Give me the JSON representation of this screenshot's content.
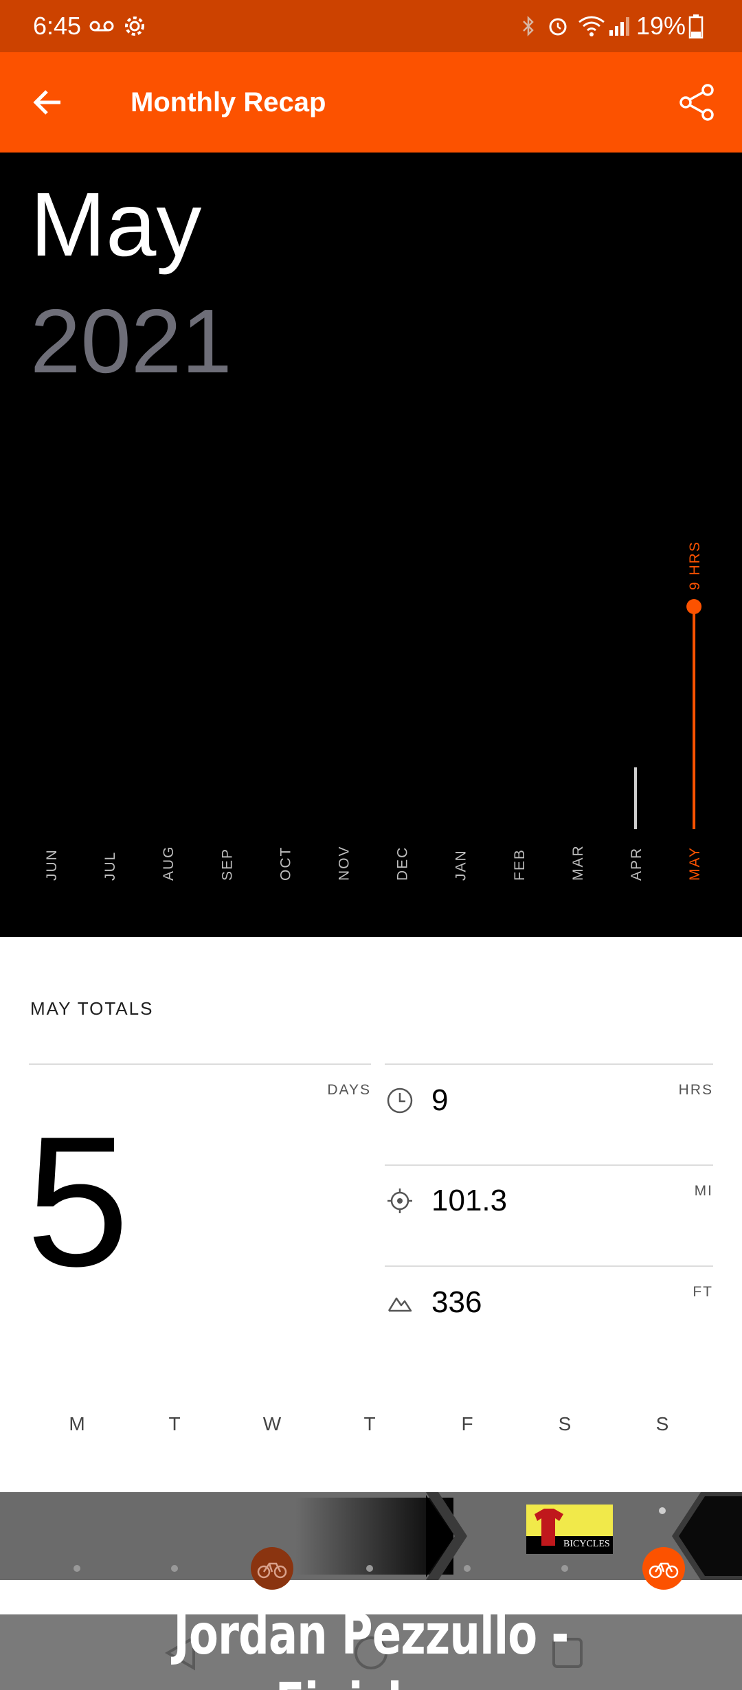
{
  "status_bar": {
    "time": "6:45",
    "battery": "19%",
    "icons": [
      "voicemail-icon",
      "settings-icon",
      "bluetooth-icon",
      "alarm-icon",
      "wifi-icon",
      "signal-icon",
      "battery-icon"
    ]
  },
  "app_bar": {
    "title": "Monthly Recap",
    "back_icon": "arrow-left-icon",
    "share_icon": "share-icon"
  },
  "hero": {
    "month": "May",
    "year": "2021"
  },
  "chart_data": {
    "type": "bar",
    "categories": [
      "JUN",
      "JUL",
      "AUG",
      "SEP",
      "OCT",
      "NOV",
      "DEC",
      "JAN",
      "FEB",
      "MAR",
      "APR",
      "MAY"
    ],
    "values": [
      0,
      0,
      0,
      0,
      0,
      0,
      0,
      0,
      0,
      0,
      2.5,
      9
    ],
    "highlight": "MAY",
    "highlight_label": "9 HRS",
    "ylim": [
      0,
      10
    ],
    "unit": "HRS",
    "colors": {
      "bar": "#cfcfcf",
      "highlight": "#fc5200",
      "axis_label": "#bdbdbd"
    }
  },
  "totals": {
    "heading": "MAY TOTALS",
    "days": {
      "value": "5",
      "unit": "DAYS"
    },
    "time": {
      "value": "9",
      "unit": "HRS",
      "icon": "clock-icon"
    },
    "distance": {
      "value": "101.3",
      "unit": "MI",
      "icon": "target-icon"
    },
    "elevation": {
      "value": "336",
      "unit": "FT",
      "icon": "mountain-icon"
    }
  },
  "week": {
    "days": [
      "M",
      "T",
      "W",
      "T",
      "F",
      "S",
      "S"
    ],
    "activity_days": [
      "W",
      "S"
    ]
  },
  "ad": {
    "thumb_text": "BICYCLES"
  },
  "overlay": {
    "caption": "Jordan Pezzullo - Finisher"
  },
  "colors": {
    "accent": "#fc5200",
    "status_bar": "#cc4200"
  }
}
